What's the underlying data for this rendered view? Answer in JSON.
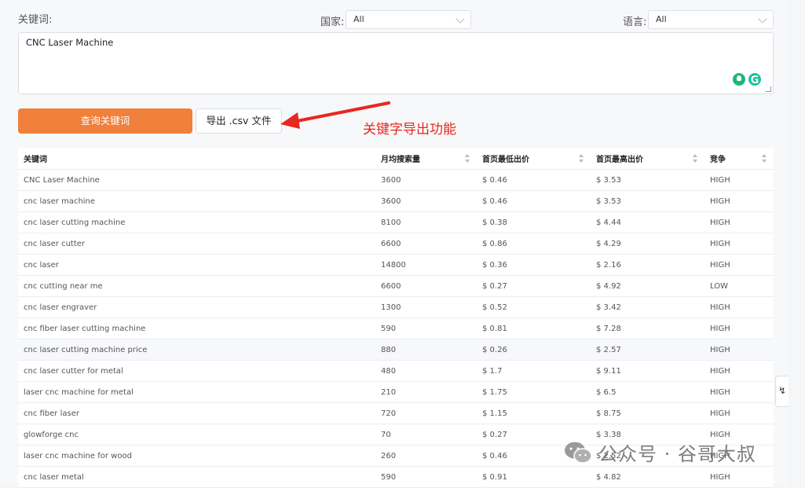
{
  "filters": {
    "keyword_label": "关键词:",
    "country_label": "国家:",
    "country_value": "All",
    "language_label": "语言:",
    "language_value": "All",
    "keyword_text": "CNC Laser Machine"
  },
  "actions": {
    "query_label": "查询关键词",
    "export_label": "导出 .csv 文件"
  },
  "annotation": "关键字导出功能",
  "table": {
    "headers": [
      "关键词",
      "月均搜索量",
      "首页最低出价",
      "首页最高出价",
      "竞争"
    ],
    "rows": [
      [
        "CNC Laser Machine",
        "3600",
        "$ 0.46",
        "$ 3.53",
        "HIGH"
      ],
      [
        "cnc laser machine",
        "3600",
        "$ 0.46",
        "$ 3.53",
        "HIGH"
      ],
      [
        "cnc laser cutting machine",
        "8100",
        "$ 0.38",
        "$ 4.44",
        "HIGH"
      ],
      [
        "cnc laser cutter",
        "6600",
        "$ 0.86",
        "$ 4.29",
        "HIGH"
      ],
      [
        "cnc laser",
        "14800",
        "$ 0.36",
        "$ 2.16",
        "HIGH"
      ],
      [
        "cnc cutting near me",
        "6600",
        "$ 0.27",
        "$ 4.92",
        "LOW"
      ],
      [
        "cnc laser engraver",
        "1300",
        "$ 0.52",
        "$ 3.42",
        "HIGH"
      ],
      [
        "cnc fiber laser cutting machine",
        "590",
        "$ 0.81",
        "$ 7.28",
        "HIGH"
      ],
      [
        "cnc laser cutting machine price",
        "880",
        "$ 0.26",
        "$ 2.57",
        "HIGH"
      ],
      [
        "cnc laser cutter for metal",
        "480",
        "$ 1.7",
        "$ 9.11",
        "HIGH"
      ],
      [
        "laser cnc machine for metal",
        "210",
        "$ 1.75",
        "$ 6.5",
        "HIGH"
      ],
      [
        "cnc fiber laser",
        "720",
        "$ 1.15",
        "$ 8.75",
        "HIGH"
      ],
      [
        "glowforge cnc",
        "70",
        "$ 0.27",
        "$ 3.38",
        "HIGH"
      ],
      [
        "laser cnc machine for wood",
        "260",
        "$ 0.46",
        "$ 2.52",
        "HIGH"
      ],
      [
        "cnc laser metal",
        "590",
        "$ 0.91",
        "$ 4.82",
        "HIGH"
      ]
    ]
  },
  "watermark": "公众号 · 谷哥大叔",
  "side_tab_glyph": "↯",
  "icons": {
    "assistant": "lightbulb-icon",
    "grammarly": "G"
  },
  "colors": {
    "primary_button": "#f0803c",
    "annotation": "#e8271e"
  }
}
